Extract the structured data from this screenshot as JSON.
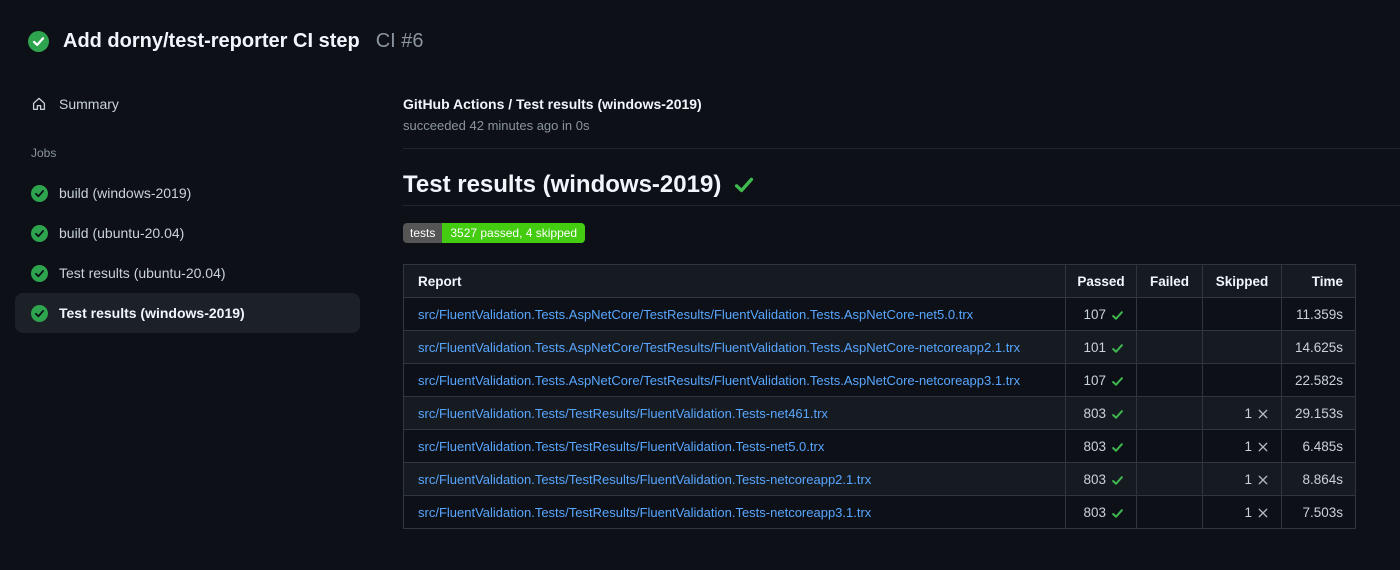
{
  "colors": {
    "green": "#2ea44f",
    "green-bright": "#3fb950",
    "link": "#58a6ff",
    "badge-label-bg": "#555555",
    "badge-value-bg": "#44cc11",
    "x-gray": "#b1bac4"
  },
  "page": {
    "title": "Add dorny/test-reporter CI step",
    "run_ref": "CI #6"
  },
  "sidebar": {
    "summary_label": "Summary",
    "jobs_label": "Jobs",
    "jobs": [
      {
        "label": "build (windows-2019)",
        "selected": false
      },
      {
        "label": "build (ubuntu-20.04)",
        "selected": false
      },
      {
        "label": "Test results (ubuntu-20.04)",
        "selected": false
      },
      {
        "label": "Test results (windows-2019)",
        "selected": true
      }
    ]
  },
  "main": {
    "check_title": "GitHub Actions / Test results (windows-2019)",
    "check_status": "succeeded 42 minutes ago in 0s",
    "section_title": "Test results (windows-2019)",
    "badge": {
      "label": "tests",
      "value": "3527 passed, 4 skipped"
    },
    "table": {
      "headers": [
        "Report",
        "Passed",
        "Failed",
        "Skipped",
        "Time"
      ],
      "rows": [
        {
          "report": "src/FluentValidation.Tests.AspNetCore/TestResults/FluentValidation.Tests.AspNetCore-net5.0.trx",
          "passed": "107",
          "failed": "",
          "skipped": "",
          "time": "11.359s"
        },
        {
          "report": "src/FluentValidation.Tests.AspNetCore/TestResults/FluentValidation.Tests.AspNetCore-netcoreapp2.1.trx",
          "passed": "101",
          "failed": "",
          "skipped": "",
          "time": "14.625s"
        },
        {
          "report": "src/FluentValidation.Tests.AspNetCore/TestResults/FluentValidation.Tests.AspNetCore-netcoreapp3.1.trx",
          "passed": "107",
          "failed": "",
          "skipped": "",
          "time": "22.582s"
        },
        {
          "report": "src/FluentValidation.Tests/TestResults/FluentValidation.Tests-net461.trx",
          "passed": "803",
          "failed": "",
          "skipped": "1",
          "time": "29.153s"
        },
        {
          "report": "src/FluentValidation.Tests/TestResults/FluentValidation.Tests-net5.0.trx",
          "passed": "803",
          "failed": "",
          "skipped": "1",
          "time": "6.485s"
        },
        {
          "report": "src/FluentValidation.Tests/TestResults/FluentValidation.Tests-netcoreapp2.1.trx",
          "passed": "803",
          "failed": "",
          "skipped": "1",
          "time": "8.864s"
        },
        {
          "report": "src/FluentValidation.Tests/TestResults/FluentValidation.Tests-netcoreapp3.1.trx",
          "passed": "803",
          "failed": "",
          "skipped": "1",
          "time": "7.503s"
        }
      ]
    }
  }
}
